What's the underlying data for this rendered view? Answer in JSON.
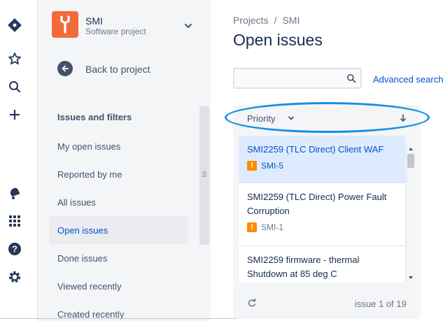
{
  "global_nav": {
    "icons": [
      "jira-logo-icon",
      "star-icon",
      "search-icon",
      "plus-icon",
      "notification-icon",
      "app-switcher-icon",
      "help-icon",
      "settings-icon"
    ]
  },
  "project": {
    "name": "SMI",
    "type": "Software project",
    "avatar_color": "#f26b3a"
  },
  "sidebar": {
    "back_label": "Back to project",
    "section_title": "Issues and filters",
    "items": [
      {
        "label": "My open issues",
        "active": false
      },
      {
        "label": "Reported by me",
        "active": false
      },
      {
        "label": "All issues",
        "active": false
      },
      {
        "label": "Open issues",
        "active": true
      },
      {
        "label": "Done issues",
        "active": false
      },
      {
        "label": "Viewed recently",
        "active": false
      },
      {
        "label": "Created recently",
        "active": false
      }
    ]
  },
  "main": {
    "breadcrumbs": [
      "Projects",
      "SMI"
    ],
    "breadcrumb_separator": "/",
    "title": "Open issues",
    "search_placeholder": "",
    "advanced_search_label": "Advanced search",
    "sort": {
      "label": "Priority",
      "direction_icon": "arrow-down-icon"
    },
    "highlight_color": "#1a8fe0",
    "issues": [
      {
        "title": "SMI2259 (TLC Direct) Client WAF",
        "key": "SMI-5",
        "priority": "!",
        "selected": true
      },
      {
        "title": "SMI2259 (TLC Direct) Power Fault Corruption",
        "key": "SMI-1",
        "priority": "!",
        "selected": false
      },
      {
        "title": "SMI2259 firmware - thermal Shutdown at 85 deg C",
        "key": "",
        "priority": "",
        "selected": false
      }
    ],
    "pager": "issue 1 of 19"
  }
}
